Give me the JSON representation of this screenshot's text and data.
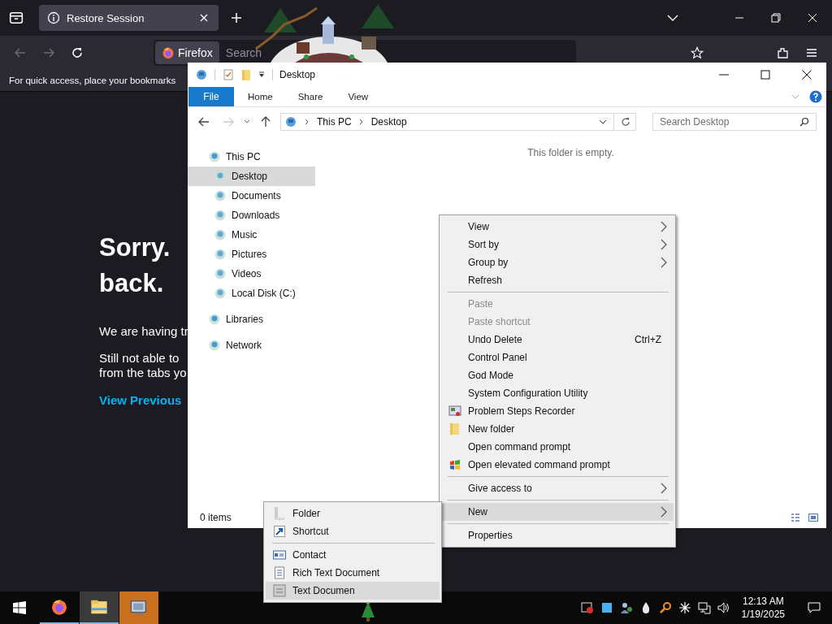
{
  "browser": {
    "tabs": [
      {
        "label": "Restore Session",
        "selected": true
      }
    ],
    "url_bar": {
      "identity": "Firefox",
      "placeholder": "Search"
    },
    "bookmarks_hint": "For quick access, place your bookmarks",
    "page": {
      "heading_lines": [
        "Sorry.",
        "back."
      ],
      "message": "We are having tr",
      "followup_lines": [
        "Still not able to",
        "from the tabs yo"
      ],
      "link": "View Previous"
    }
  },
  "explorer": {
    "title": "Desktop",
    "ribbon_tabs": [
      {
        "label": "File",
        "kind": "file"
      },
      {
        "label": "Home",
        "kind": "tab"
      },
      {
        "label": "Share",
        "kind": "tab"
      },
      {
        "label": "View",
        "kind": "tab"
      }
    ],
    "breadcrumb": [
      "This PC",
      "Desktop"
    ],
    "search": {
      "placeholder": "Search Desktop"
    },
    "nav": [
      {
        "label": "This PC",
        "selected": false,
        "children": [
          {
            "label": "Desktop",
            "selected": true
          },
          {
            "label": "Documents",
            "selected": false
          },
          {
            "label": "Downloads",
            "selected": false
          },
          {
            "label": "Music",
            "selected": false
          },
          {
            "label": "Pictures",
            "selected": false
          },
          {
            "label": "Videos",
            "selected": false
          },
          {
            "label": "Local Disk (C:)",
            "selected": false
          }
        ]
      },
      {
        "label": "Libraries",
        "selected": false
      },
      {
        "label": "Network",
        "selected": false
      }
    ],
    "empty_message": "This folder is empty.",
    "status": "0 items"
  },
  "context_menu": {
    "items": [
      {
        "kind": "plain",
        "label": "View",
        "submenu": true,
        "disabled": false,
        "highlighted": false
      },
      {
        "kind": "plain",
        "label": "Sort by",
        "submenu": true,
        "disabled": false,
        "highlighted": false
      },
      {
        "kind": "plain",
        "label": "Group by",
        "submenu": true,
        "disabled": false,
        "highlighted": false
      },
      {
        "kind": "plain",
        "label": "Refresh",
        "submenu": false,
        "disabled": false,
        "highlighted": false
      },
      {
        "kind": "separator"
      },
      {
        "kind": "plain",
        "label": "Paste",
        "submenu": false,
        "disabled": true,
        "highlighted": false
      },
      {
        "kind": "plain",
        "label": "Paste shortcut",
        "submenu": false,
        "disabled": true,
        "highlighted": false
      },
      {
        "kind": "plain",
        "label": "Undo Delete",
        "shortcut": "Ctrl+Z",
        "submenu": false,
        "disabled": false,
        "highlighted": false
      },
      {
        "kind": "plain",
        "label": "Control Panel",
        "submenu": false,
        "disabled": false,
        "highlighted": false
      },
      {
        "kind": "plain",
        "label": "God Mode",
        "submenu": false,
        "disabled": false,
        "highlighted": false
      },
      {
        "kind": "plain",
        "label": "System Configuration Utility",
        "submenu": false,
        "disabled": false,
        "highlighted": false
      },
      {
        "kind": "recorder",
        "label": "Problem Steps Recorder",
        "submenu": false,
        "disabled": false,
        "highlighted": false
      },
      {
        "kind": "folder",
        "label": "New folder",
        "submenu": false,
        "disabled": false,
        "highlighted": false
      },
      {
        "kind": "plain",
        "label": "Open command prompt",
        "submenu": false,
        "disabled": false,
        "highlighted": false
      },
      {
        "kind": "flag",
        "label": "Open elevated command prompt",
        "submenu": false,
        "disabled": false,
        "highlighted": false
      },
      {
        "kind": "separator"
      },
      {
        "kind": "plain",
        "label": "Give access to",
        "submenu": true,
        "disabled": false,
        "highlighted": false
      },
      {
        "kind": "separator"
      },
      {
        "kind": "plain",
        "label": "New",
        "submenu": true,
        "disabled": false,
        "highlighted": true
      },
      {
        "kind": "separator"
      },
      {
        "kind": "plain",
        "label": "Properties",
        "submenu": false,
        "disabled": false,
        "highlighted": false
      }
    ]
  },
  "new_submenu": {
    "items": [
      {
        "kind": "folder",
        "label": "Folder",
        "highlighted": false
      },
      {
        "kind": "shortcut",
        "label": "Shortcut",
        "highlighted": false
      },
      {
        "kind": "separator"
      },
      {
        "kind": "contact",
        "label": "Contact",
        "highlighted": false
      },
      {
        "kind": "document",
        "label": "Rich Text Document",
        "highlighted": false
      },
      {
        "kind": "notepad",
        "label": "Text Documen",
        "highlighted": true
      }
    ]
  },
  "taskbar": {
    "apps": [
      {
        "kind": "firefox",
        "active": false,
        "flashing": false
      },
      {
        "kind": "explorer",
        "active": true,
        "flashing": false
      },
      {
        "kind": "tool",
        "active": false,
        "flashing": true
      }
    ],
    "clock": {
      "time": "12:13 AM",
      "date": "1/19/2025"
    }
  }
}
